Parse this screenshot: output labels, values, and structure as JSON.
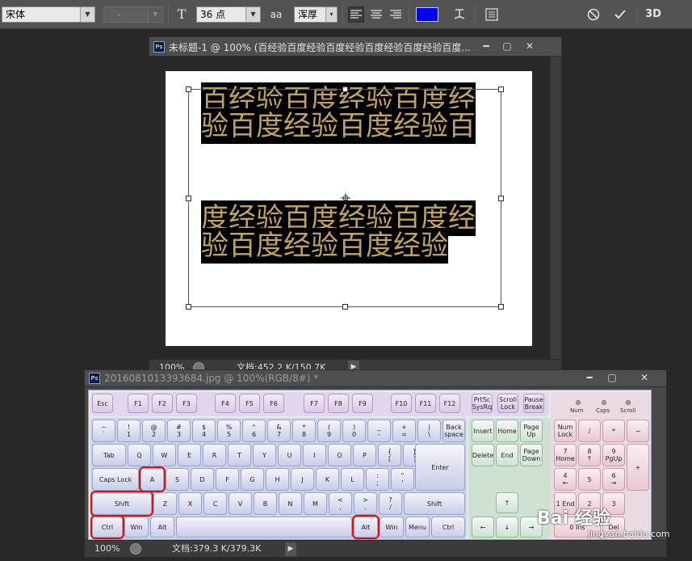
{
  "options_bar": {
    "font_family": "宋体",
    "font_style": "-",
    "font_size": "36 点",
    "aa_icon_text": "aa",
    "anti_alias": "浑厚",
    "text_color": "#0000ff",
    "threed_label": "3D"
  },
  "doc1": {
    "title": "未标题-1 @ 100% (百经验百度经验百度经验百度经验百度经验百度...",
    "ps_label": "Ps",
    "zoom": "100%",
    "doc_info": "文档:452.2 K/150.7K",
    "text_lines": [
      "百经验百度经验百度经",
      "验百度经验百度经验百",
      "度经验百度经验百度经",
      "验百度经验百度经验"
    ],
    "text_color": "#c4a25f"
  },
  "doc2": {
    "title": "2016081013393684.jpg @ 100%(RGB/8#) *",
    "ps_label": "Ps",
    "zoom": "100%",
    "doc_info": "文档:379.3 K/379.3K",
    "led_labels": [
      "Num",
      "Caps",
      "Scroll"
    ]
  },
  "keyboard": {
    "fkeys": [
      "Esc",
      "F1",
      "F2",
      "F3",
      "F4",
      "F5",
      "F6",
      "F7",
      "F8",
      "F9",
      "F10",
      "F11",
      "F12",
      "PrtSc SysRq",
      "Scroll Lock",
      "Pause Break"
    ],
    "row1": [
      "~ `",
      "! 1",
      "@ 2",
      "# 3",
      "$ 4",
      "% 5",
      "^ 6",
      "& 7",
      "* 8",
      "( 9",
      ") 0",
      "_ -",
      "+ =",
      "| \\",
      "Back space"
    ],
    "row2": [
      "Tab",
      "Q",
      "W",
      "E",
      "R",
      "T",
      "Y",
      "U",
      "I",
      "O",
      "P",
      "{ [",
      "} ]",
      "Enter"
    ],
    "row3": [
      "Caps Lock",
      "A",
      "S",
      "D",
      "F",
      "G",
      "H",
      "J",
      "K",
      "L",
      ": ;",
      "\" '"
    ],
    "row4": [
      "Shift",
      "Z",
      "X",
      "C",
      "V",
      "B",
      "N",
      "M",
      "< ,",
      "> .",
      "? /",
      "Shift"
    ],
    "row5": [
      "Ctrl",
      "Win",
      "Alt",
      "",
      "Alt",
      "Win",
      "Menu",
      "Ctrl"
    ],
    "nav": [
      "Insert",
      "Home",
      "Page Up",
      "Delete",
      "End",
      "Page Down"
    ],
    "arrows": [
      "↑",
      "←",
      "↓",
      "→"
    ],
    "numpad": [
      "Num Lock",
      "/",
      "*",
      "−",
      "7 Home",
      "8 ↑",
      "9 PgUp",
      "+",
      "4 ←",
      "5",
      "6 →",
      "1 End",
      "2",
      "3",
      "0 Ins",
      "Del"
    ]
  },
  "watermark": {
    "brand": "Bai  经验",
    "url": "jingyan.baidu.com"
  }
}
